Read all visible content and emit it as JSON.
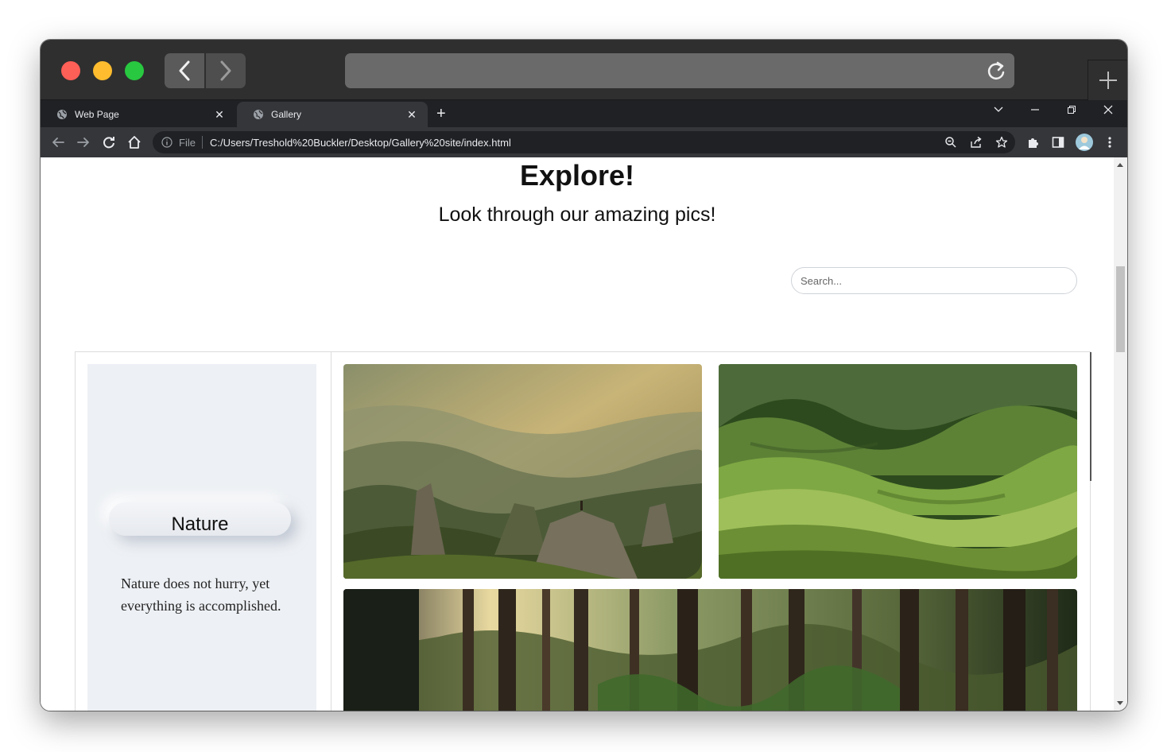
{
  "browser": {
    "tabs": [
      {
        "label": "Web Page"
      },
      {
        "label": "Gallery"
      }
    ],
    "address": {
      "scheme_label": "File",
      "url": "C:/Users/Treshold%20Buckler/Desktop/Gallery%20site/index.html"
    }
  },
  "page": {
    "title": "Explore!",
    "subtitle": "Look through our amazing pics!",
    "search": {
      "placeholder": "Search...",
      "value": ""
    },
    "sidebar": {
      "category": "Nature",
      "quote": "Nature does not hurry, yet everything is accomplished."
    },
    "images": [
      {
        "name": "mountain-valley-photo",
        "colors": [
          "#c8b477",
          "#5f6b4a",
          "#2d3b22"
        ]
      },
      {
        "name": "green-hills-photo",
        "colors": [
          "#9fbf5a",
          "#3f6b1f",
          "#1e3a12"
        ]
      },
      {
        "name": "forest-trees-photo",
        "colors": [
          "#e8d9a0",
          "#4a5a2e",
          "#1a1f18"
        ]
      }
    ]
  },
  "colors": {
    "titlebar": "#2f2f2f",
    "tabstrip": "#202124",
    "toolbar": "#35363a",
    "sidebar_card": "#edf0f4"
  }
}
